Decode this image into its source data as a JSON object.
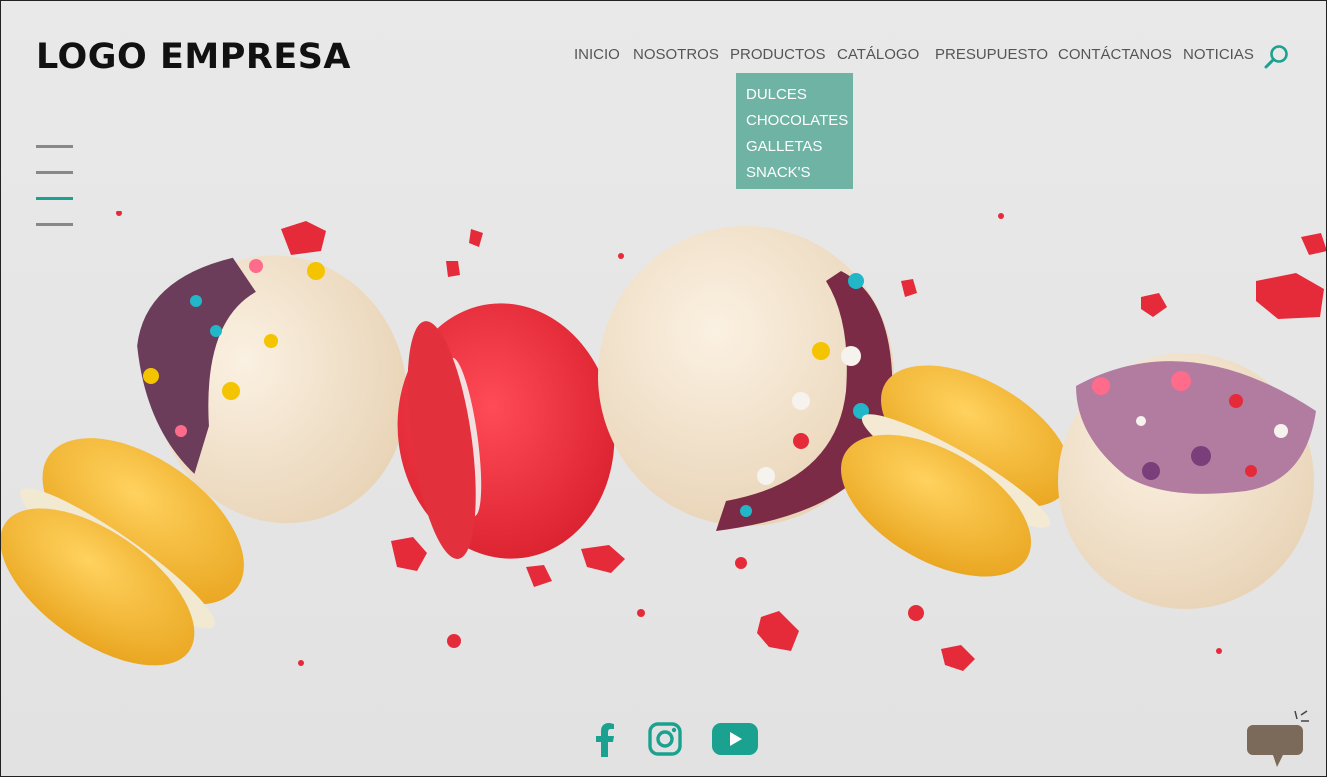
{
  "logo": "LOGO EMPRESA",
  "nav": [
    {
      "label": "INICIO"
    },
    {
      "label": "NOSOTROS"
    },
    {
      "label": "PRODUCTOS"
    },
    {
      "label": "CATÁLOGO"
    },
    {
      "label": "PRESUPUESTO"
    },
    {
      "label": "CONTÁCTANOS"
    },
    {
      "label": "NOTICIAS"
    }
  ],
  "dropdown": {
    "items": [
      "DULCES",
      "CHOCOLATES",
      "GALLETAS",
      "SNACK'S"
    ]
  },
  "icons": {
    "search": "search-icon",
    "menu": "hamburger-menu-icon",
    "facebook": "facebook-icon",
    "instagram": "instagram-icon",
    "youtube": "youtube-icon",
    "chat": "chat-bubble-icon"
  },
  "colors": {
    "accent": "#1aa190",
    "dropdown_bg": "#6fb3a5",
    "text": "#555555",
    "logo": "#111111"
  }
}
